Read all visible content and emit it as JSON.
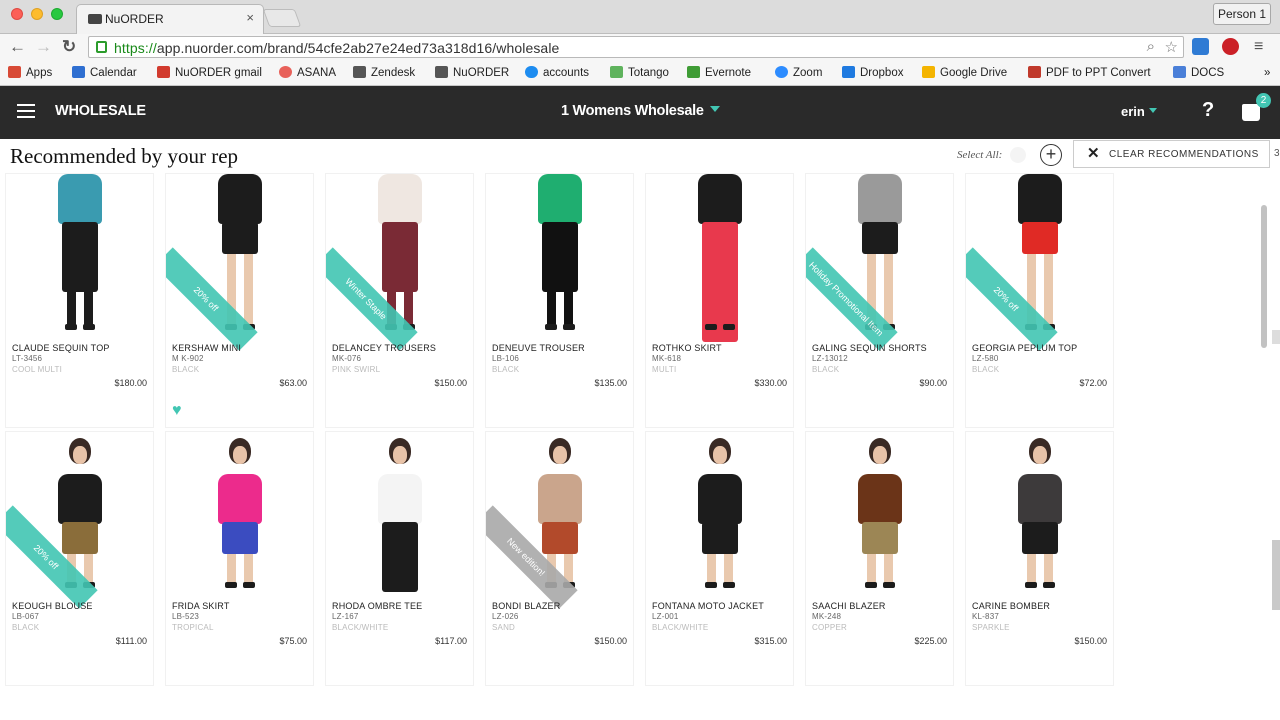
{
  "browser": {
    "tab_title": "NuORDER",
    "tab_close": "×",
    "person": "Person 1",
    "url_scheme": "https://",
    "url_rest": "app.nuorder.com/brand/54cfe2ab27e24ed73a318d16/wholesale",
    "back_icon": "←",
    "forward_icon": "→",
    "reload_icon": "↻",
    "bookmarks": [
      "Apps",
      "Calendar",
      "NuORDER gmail",
      "ASANA",
      "Zendesk",
      "NuORDER",
      "accounts",
      "Totango",
      "Evernote",
      "Zoom",
      "Dropbox",
      "Google Drive",
      "PDF to PPT Convert",
      "DOCS"
    ],
    "bookmarks_more": "»"
  },
  "app": {
    "title": "WHOLESALE",
    "line": "1 Womens Wholesale",
    "user": "erin",
    "help": "?",
    "cart_count": "2"
  },
  "section": {
    "title": "Recommended by your rep",
    "select_all": "Select All:",
    "add": "+",
    "clear_x": "✕",
    "clear_label": "CLEAR RECOMMENDATIONS",
    "edge_text": "3"
  },
  "accent_color": "#42c6b3",
  "products_row1": [
    {
      "name": "CLAUDE SEQUIN TOP",
      "sku": "LT-3456",
      "color": "COOL MULTI",
      "price": "$180.00",
      "ribbon": ""
    },
    {
      "name": "KERSHAW MINI",
      "sku": "M K-902",
      "color": "BLACK",
      "price": "$63.00",
      "ribbon": "20% off"
    },
    {
      "name": "DELANCEY TROUSERS",
      "sku": "MK-076",
      "color": "PINK SWIRL",
      "price": "$150.00",
      "ribbon": "Winter Staple"
    },
    {
      "name": "DENEUVE TROUSER",
      "sku": "LB-106",
      "color": "BLACK",
      "price": "$135.00",
      "ribbon": ""
    },
    {
      "name": "ROTHKO SKIRT",
      "sku": "MK-618",
      "color": "MULTI",
      "price": "$330.00",
      "ribbon": ""
    },
    {
      "name": "GALING SEQUIN SHORTS",
      "sku": "LZ-13012",
      "color": "BLACK",
      "price": "$90.00",
      "ribbon": "Holiday Promotional Item"
    },
    {
      "name": "GEORGIA PEPLUM TOP",
      "sku": "LZ-580",
      "color": "BLACK",
      "price": "$72.00",
      "ribbon": "20% off"
    }
  ],
  "products_row2": [
    {
      "name": "KEOUGH BLOUSE",
      "sku": "LB-067",
      "color": "BLACK",
      "price": "$111.00",
      "ribbon": "20% off"
    },
    {
      "name": "FRIDA SKIRT",
      "sku": "LB-523",
      "color": "TROPICAL",
      "price": "$75.00",
      "ribbon": ""
    },
    {
      "name": "RHODA OMBRE TEE",
      "sku": "LZ-167",
      "color": "BLACK/WHITE",
      "price": "$117.00",
      "ribbon": ""
    },
    {
      "name": "BONDI BLAZER",
      "sku": "LZ-026",
      "color": "SAND",
      "price": "$150.00",
      "ribbon": "New edition!"
    },
    {
      "name": "FONTANA MOTO JACKET",
      "sku": "LZ-001",
      "color": "BLACK/WHITE",
      "price": "$315.00",
      "ribbon": ""
    },
    {
      "name": "SAACHI BLAZER",
      "sku": "MK-248",
      "color": "COPPER",
      "price": "$225.00",
      "ribbon": ""
    },
    {
      "name": "CARINE BOMBER",
      "sku": "KL-837",
      "color": "SPARKLE",
      "price": "$150.00",
      "ribbon": ""
    }
  ]
}
